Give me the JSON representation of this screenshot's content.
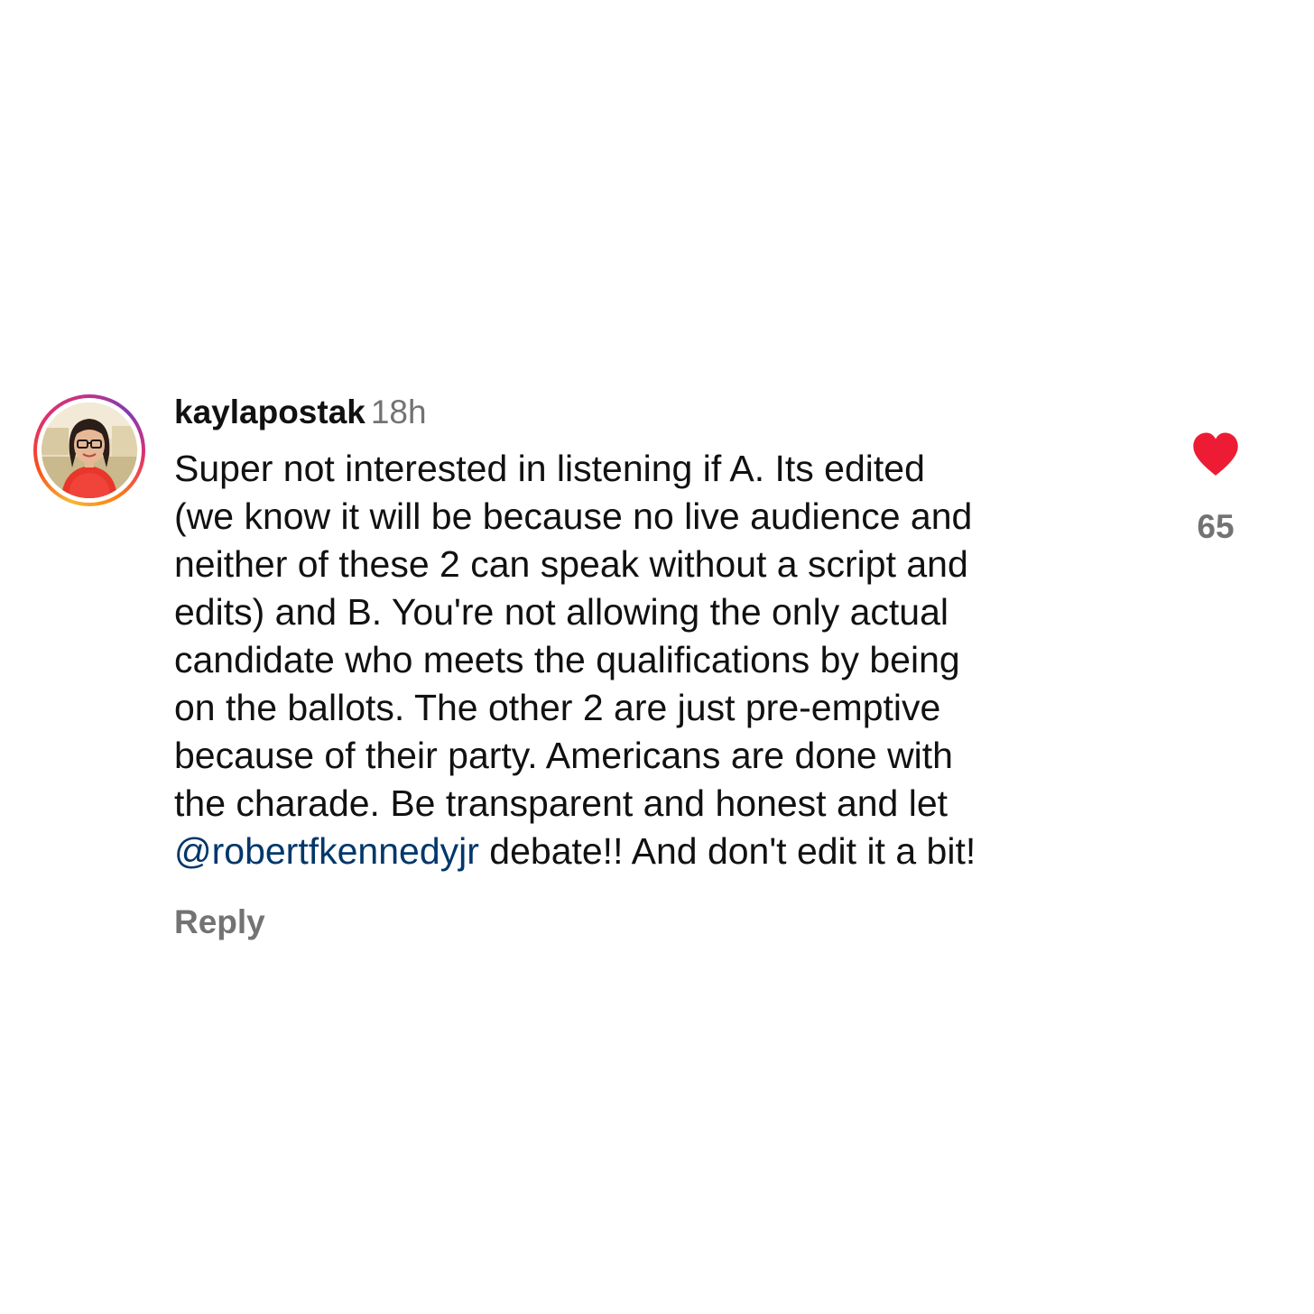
{
  "comment": {
    "username": "kaylapostak",
    "timestamp": "18h",
    "avatar_icon": "profile-photo",
    "text_lines": [
      "Super not interested in listening if A. Its edited",
      "(we know it will be because no live audience and",
      "neither of these 2 can speak without a script and",
      "edits) and B. You're not allowing the only actual",
      "candidate who meets the qualifications by being",
      "on the ballots. The other 2 are just pre-emptive",
      "because of their party. Americans are done with",
      "the charade. Be transparent and honest and let"
    ],
    "mention": "@robertfkennedyjr",
    "last_line_rest": " debate!! And don't edit it a bit!",
    "reply_label": "Reply",
    "like_icon": "heart-icon",
    "like_count": "65",
    "liked": true
  },
  "colors": {
    "text": "#111111",
    "secondary": "#737373",
    "mention": "#00376b",
    "heart": "#ed1c34"
  }
}
